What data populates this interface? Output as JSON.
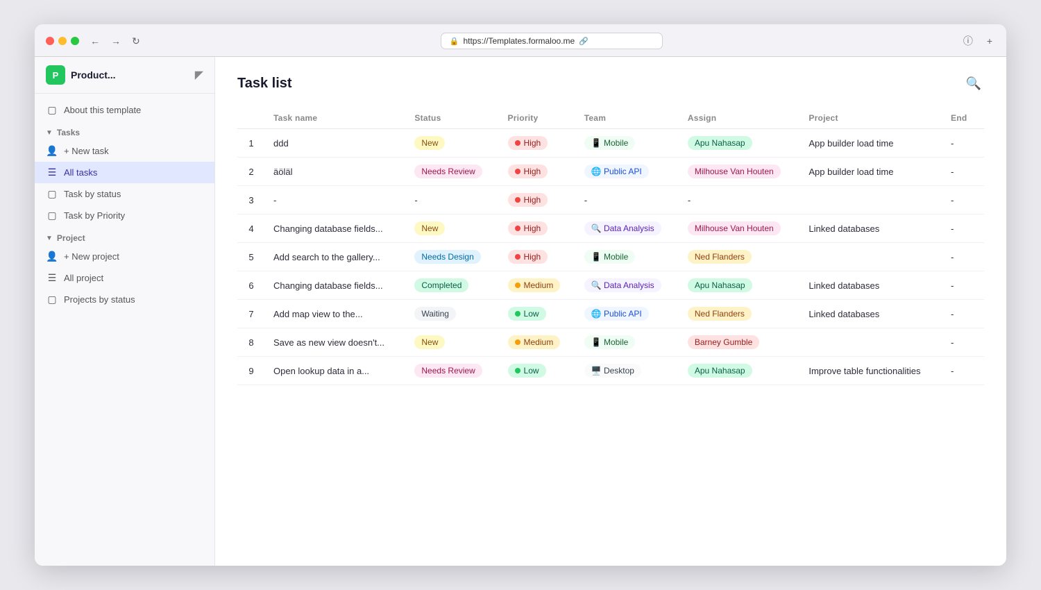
{
  "browser": {
    "url": "https://Templates.formaloo.me",
    "back_btn": "←",
    "forward_btn": "→",
    "refresh_btn": "↻"
  },
  "sidebar": {
    "product_initial": "P",
    "product_title": "Product...",
    "about_label": "About this template",
    "tasks_section": "Tasks",
    "new_task_label": "+ New task",
    "all_tasks_label": "All tasks",
    "task_by_status_label": "Task by status",
    "task_by_priority_label": "Task by Priority",
    "project_section": "Project",
    "new_project_label": "+ New project",
    "all_project_label": "All project",
    "projects_by_status_label": "Projects by status"
  },
  "main": {
    "page_title": "Task list",
    "columns": {
      "num": "#",
      "task_name": "Task name",
      "status": "Status",
      "priority": "Priority",
      "team": "Team",
      "assign": "Assign",
      "project": "Project",
      "end": "End"
    },
    "rows": [
      {
        "num": "1",
        "task_name": "ddd",
        "status": "New",
        "status_class": "status-new",
        "priority": "High",
        "priority_class": "priority-high",
        "priority_dot": "dot-high",
        "team": "📱 Mobile",
        "team_class": "team-mobile",
        "assign": "Apu Nahasap",
        "assign_class": "assign-apu",
        "project": "App builder load time",
        "end": "-"
      },
      {
        "num": "2",
        "task_name": "äöläl",
        "status": "Needs Review",
        "status_class": "status-needs-review",
        "priority": "High",
        "priority_class": "priority-high",
        "priority_dot": "dot-high",
        "team": "🌐 Public API",
        "team_class": "team-public-api",
        "assign": "Milhouse Van Houten",
        "assign_class": "assign-milhouse",
        "project": "App builder load time",
        "end": "-"
      },
      {
        "num": "3",
        "task_name": "-",
        "status": "-",
        "status_class": "",
        "priority": "High",
        "priority_class": "priority-high",
        "priority_dot": "dot-high",
        "team": "-",
        "team_class": "",
        "assign": "-",
        "assign_class": "",
        "project": "",
        "end": "-"
      },
      {
        "num": "4",
        "task_name": "Changing database fields...",
        "status": "New",
        "status_class": "status-new",
        "priority": "High",
        "priority_class": "priority-high",
        "priority_dot": "dot-high",
        "team": "🔍 Data Analysis",
        "team_class": "team-data",
        "assign": "Milhouse Van Houten",
        "assign_class": "assign-milhouse",
        "project": "Linked databases",
        "end": "-"
      },
      {
        "num": "5",
        "task_name": "Add search to the gallery...",
        "status": "Needs Design",
        "status_class": "status-needs-design",
        "priority": "High",
        "priority_class": "priority-high",
        "priority_dot": "dot-high",
        "team": "📱 Mobile",
        "team_class": "team-mobile",
        "assign": "Ned Flanders",
        "assign_class": "assign-ned",
        "project": "",
        "end": "-"
      },
      {
        "num": "6",
        "task_name": "Changing database fields...",
        "status": "Completed",
        "status_class": "status-completed",
        "priority": "Medium",
        "priority_class": "priority-medium",
        "priority_dot": "dot-medium",
        "team": "🔍 Data Analysis",
        "team_class": "team-data",
        "assign": "Apu Nahasap",
        "assign_class": "assign-apu",
        "project": "Linked databases",
        "end": "-"
      },
      {
        "num": "7",
        "task_name": "Add map view to the...",
        "status": "Waiting",
        "status_class": "status-waiting",
        "priority": "Low",
        "priority_class": "priority-low",
        "priority_dot": "dot-low",
        "team": "🌐 Public API",
        "team_class": "team-public-api",
        "assign": "Ned Flanders",
        "assign_class": "assign-ned",
        "project": "Linked databases",
        "end": "-"
      },
      {
        "num": "8",
        "task_name": "Save as new view doesn't...",
        "status": "New",
        "status_class": "status-new",
        "priority": "Medium",
        "priority_class": "priority-medium",
        "priority_dot": "dot-medium",
        "team": "📱 Mobile",
        "team_class": "team-mobile",
        "assign": "Barney Gumble",
        "assign_class": "assign-barney",
        "project": "",
        "end": "-"
      },
      {
        "num": "9",
        "task_name": "Open lookup data in a...",
        "status": "Needs Review",
        "status_class": "status-needs-review",
        "priority": "Low",
        "priority_class": "priority-low",
        "priority_dot": "dot-low",
        "team": "🖥️ Desktop",
        "team_class": "team-desktop",
        "assign": "Apu Nahasap",
        "assign_class": "assign-apu",
        "project": "Improve table functionalities",
        "end": "-"
      }
    ]
  }
}
